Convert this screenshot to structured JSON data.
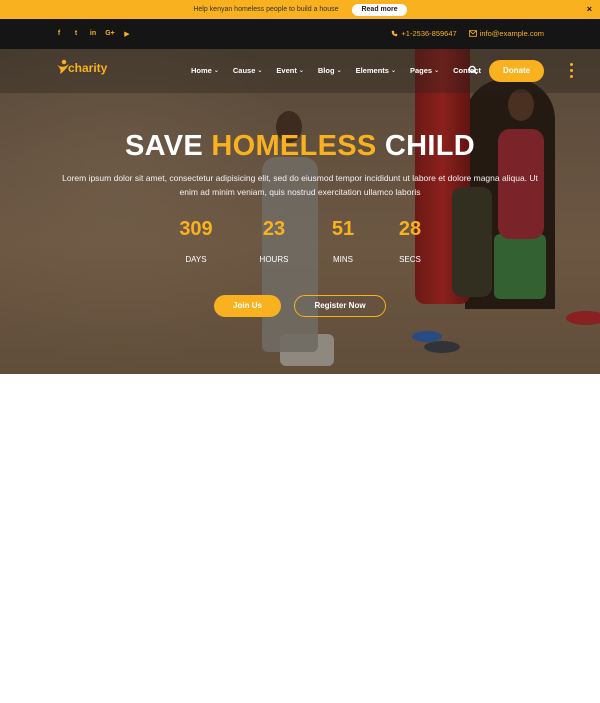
{
  "announcement": {
    "text": "Help kenyan homeless people to build a house",
    "button_label": "Read more",
    "close_label": "×"
  },
  "topbar": {
    "social_icons": [
      "facebook-icon",
      "twitter-icon",
      "linkedin-icon",
      "google-plus-icon",
      "youtube-icon"
    ],
    "social_glyphs": [
      "f",
      "t",
      "in",
      "G+",
      "▶"
    ],
    "phone": "+1-2536-859647",
    "email": "info@example.com"
  },
  "nav": {
    "logo_text": "charity",
    "items": [
      {
        "label": "Home",
        "dropdown": true
      },
      {
        "label": "Cause",
        "dropdown": true
      },
      {
        "label": "Event",
        "dropdown": true
      },
      {
        "label": "Blog",
        "dropdown": true
      },
      {
        "label": "Elements",
        "dropdown": true
      },
      {
        "label": "Pages",
        "dropdown": true
      },
      {
        "label": "Contact",
        "dropdown": false
      }
    ],
    "donate_label": "Donate"
  },
  "hero": {
    "title_part1": "SAVE",
    "title_accent": "HOMELESS",
    "title_part2": "CHILD",
    "description": "Lorem ipsum dolor sit amet, consectetur adipisicing elit, sed do eiusmod tempor incididunt ut labore et dolore magna aliqua. Ut enim ad minim veniam, quis nostrud exercitation ullamco laboris",
    "countdown": [
      {
        "value": "309",
        "label": "DAYS"
      },
      {
        "value": "23",
        "label": "HOURS"
      },
      {
        "value": "51",
        "label": "MINS"
      },
      {
        "value": "28",
        "label": "SECS"
      }
    ],
    "join_label": "Join Us",
    "register_label": "Register Now"
  },
  "colors": {
    "accent": "#f9b120",
    "topbar_bg": "#151515"
  }
}
